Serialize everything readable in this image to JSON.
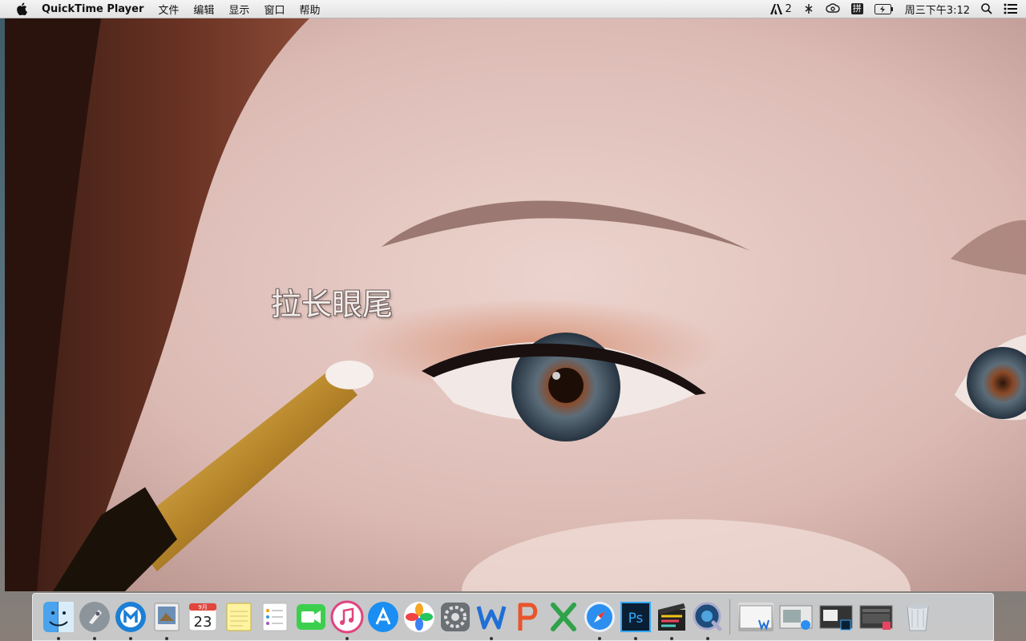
{
  "menubar": {
    "app_name": "QuickTime Player",
    "menus": [
      "文件",
      "编辑",
      "显示",
      "窗口",
      "帮助"
    ],
    "adobe_badge": "2",
    "input_method": "拼",
    "clock": "周三下午3:12"
  },
  "video": {
    "caption": "拉长眼尾"
  },
  "dock": {
    "calendar_month": "9月",
    "calendar_day": "23",
    "apps": [
      "finder",
      "launchpad",
      "maxthon",
      "preview",
      "calendar",
      "notes",
      "reminders",
      "facetime",
      "itunes",
      "app-store",
      "photos",
      "system-preferences",
      "wps-writer",
      "wps-presentation",
      "wps-spreadsheet",
      "safari",
      "photoshop",
      "final-cut-pro",
      "quicktime-player"
    ],
    "running": [
      "finder",
      "launchpad",
      "maxthon",
      "preview",
      "itunes",
      "wps-writer",
      "safari",
      "photoshop",
      "final-cut-pro",
      "quicktime-player"
    ]
  }
}
